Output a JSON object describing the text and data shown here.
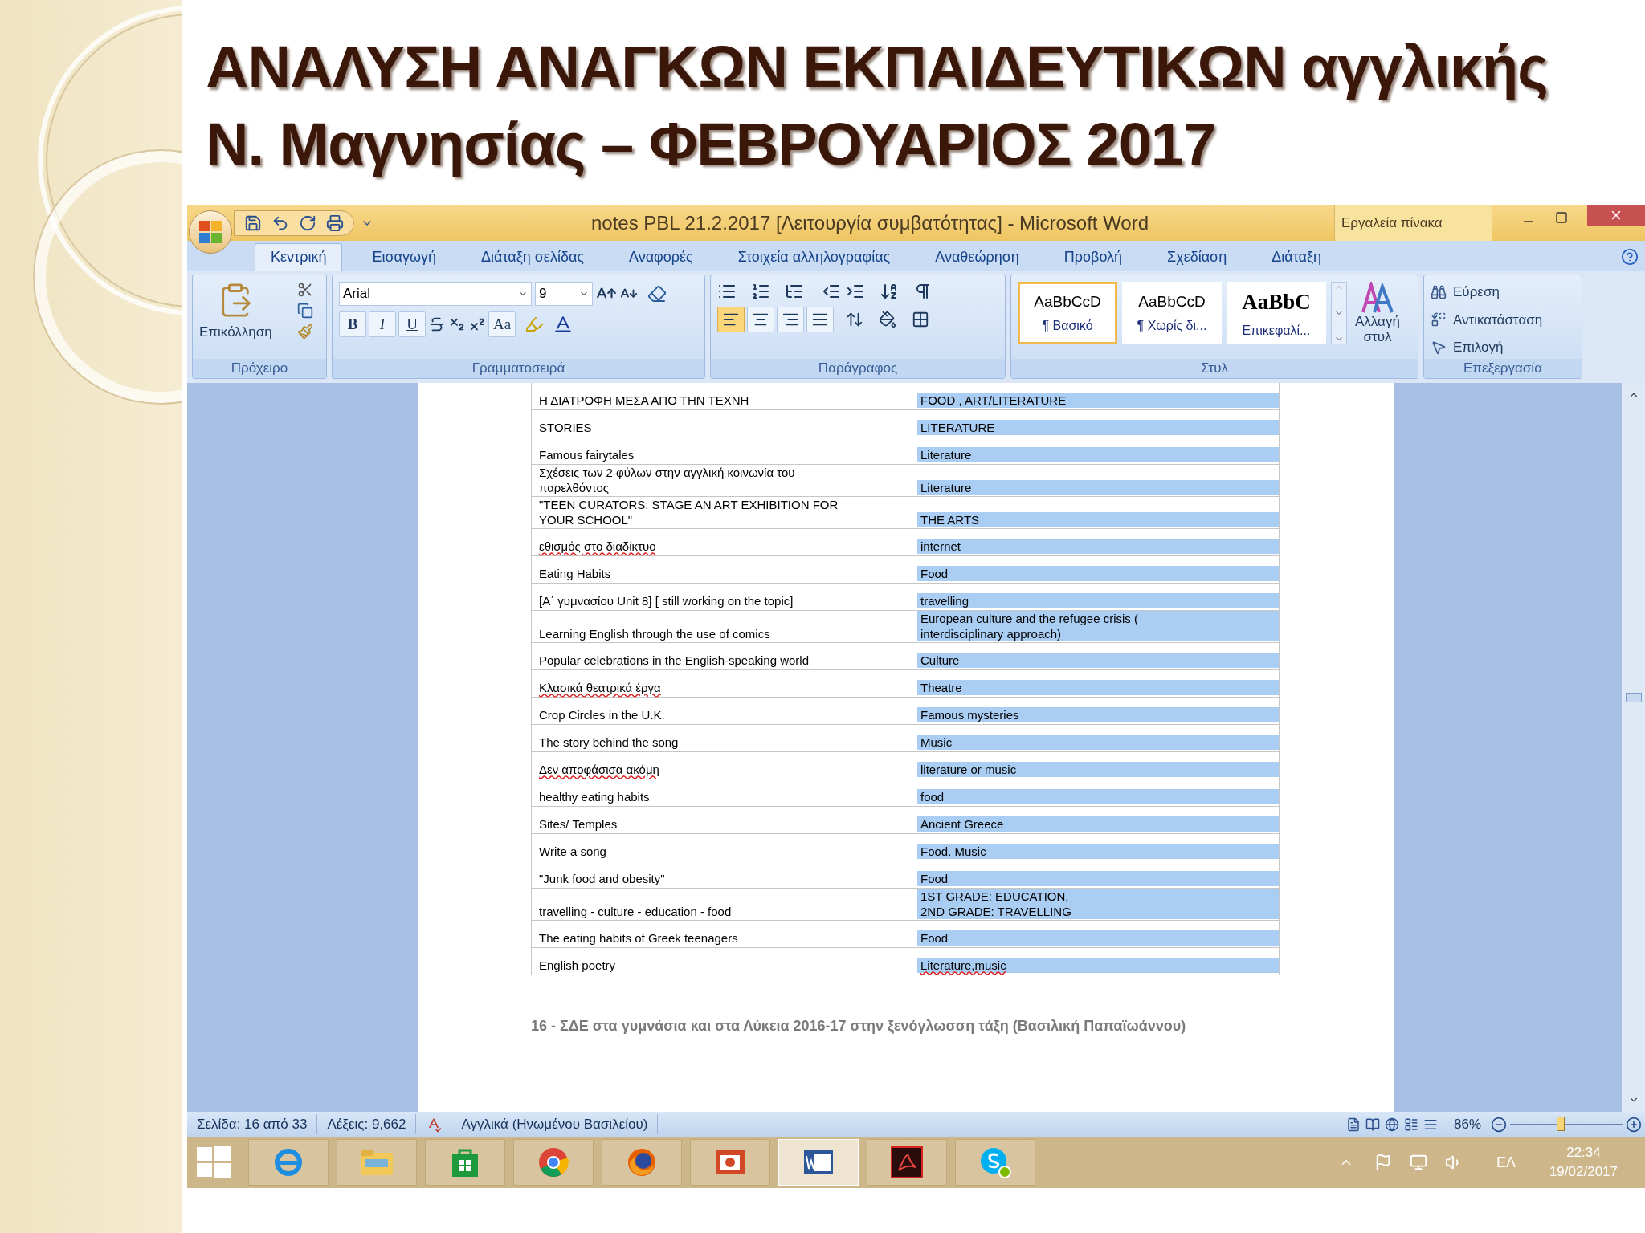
{
  "slide": {
    "title_lines": [
      "ΑΝΑΛΥΣΗ ΑΝΑΓΚΩΝ ΕΚΠΑΙΔΕΥΤΙΚΩΝ αγγλικής",
      "Ν. Μαγνησίας – ΦΕΒΡΟΥΑΡΙΟΣ 2017"
    ]
  },
  "window": {
    "title": "notes PBL 21.2.2017 [Λειτουργία συμβατότητας] - Microsoft Word",
    "context_group": "Εργαλεία πίνακα"
  },
  "tabs": [
    {
      "label": "Κεντρική",
      "selected": true
    },
    {
      "label": "Εισαγωγή",
      "selected": false
    },
    {
      "label": "Διάταξη σελίδας",
      "selected": false
    },
    {
      "label": "Αναφορές",
      "selected": false
    },
    {
      "label": "Στοιχεία αλληλογραφίας",
      "selected": false
    },
    {
      "label": "Αναθεώρηση",
      "selected": false
    },
    {
      "label": "Προβολή",
      "selected": false
    },
    {
      "label": "Σχεδίαση",
      "selected": false
    },
    {
      "label": "Διάταξη",
      "selected": false
    }
  ],
  "ribbon": {
    "clipboard": {
      "label": "Πρόχειρο",
      "paste": "Επικόλληση"
    },
    "font": {
      "label": "Γραμματοσειρά",
      "family": "Arial",
      "size": "9",
      "format_buttons": [
        "B",
        "I",
        "U",
        "Aa"
      ]
    },
    "paragraph": {
      "label": "Παράγραφος",
      "align_buttons": [
        {
          "kind": "left",
          "selected": true
        },
        {
          "kind": "center",
          "selected": false
        },
        {
          "kind": "right",
          "selected": false
        },
        {
          "kind": "justify",
          "selected": false
        }
      ]
    },
    "styles": {
      "label": "Στυλ",
      "gallery": [
        {
          "preview": "AaBbCcD",
          "name": "¶ Βασικό",
          "kind": "normal",
          "selected": true
        },
        {
          "preview": "AaBbCcD",
          "name": "¶ Χωρίς δι...",
          "kind": "normal",
          "selected": false
        },
        {
          "preview": "AaBbC",
          "name": "Επικεφαλί...",
          "kind": "heading",
          "selected": false
        }
      ],
      "change": [
        "Αλλαγή",
        "στυλ"
      ]
    },
    "editing": {
      "label": "Επεξεργασία",
      "items": [
        {
          "kind": "find",
          "label": "Εύρεση"
        },
        {
          "kind": "replace",
          "label": "Αντικατάσταση"
        },
        {
          "kind": "select",
          "label": "Επιλογή"
        }
      ]
    }
  },
  "document": {
    "rows": [
      {
        "cells": [
          {
            "text": "Η ΔΙΑΤΡΟΦΗ ΜΕΣΑ ΑΠΟ ΤΗΝ ΤΕΧΝΗ",
            "selected": false
          },
          {
            "text": "FOOD , ART/LITERATURE",
            "selected": true
          }
        ]
      },
      {
        "cells": [
          {
            "text": "STORIES",
            "selected": false
          },
          {
            "text": "LITERATURE",
            "selected": true
          }
        ]
      },
      {
        "cells": [
          {
            "text": "Famous fairytales",
            "selected": false
          },
          {
            "text": "Literature",
            "selected": true
          }
        ]
      },
      {
        "cells": [
          {
            "text": "Σχέσεις  των 2 φύλων στην  αγγλική κοινωνία του\nπαρελθόντος",
            "selected": false
          },
          {
            "text": "Literature",
            "selected": true
          }
        ]
      },
      {
        "cells": [
          {
            "text": "\"TEEN CURATORS:  STAGE AN ART EXHIBITION FOR\nYOUR SCHOOL\"",
            "selected": false
          },
          {
            "text": "THE ARTS",
            "selected": true
          }
        ]
      },
      {
        "cells": [
          {
            "text": "εθισμός στο διαδίκτυο",
            "selected": false,
            "spell_error": true
          },
          {
            "text": "internet",
            "selected": true
          }
        ]
      },
      {
        "cells": [
          {
            "text": "Eating Habits",
            "selected": false
          },
          {
            "text": "Food",
            "selected": true
          }
        ]
      },
      {
        "cells": [
          {
            "text": "[Α΄ γυμνασίου  Unit 8] [ still working on the topic]",
            "selected": false
          },
          {
            "text": "travelling",
            "selected": true
          }
        ]
      },
      {
        "cells": [
          {
            "text": "Learning English through the use of comics",
            "selected": false
          },
          {
            "text": "European culture and the refugee crisis  (\ninterdisciplinary approach)",
            "selected": true
          }
        ]
      },
      {
        "cells": [
          {
            "text": "Popular celebrations in the English-speaking world",
            "selected": false
          },
          {
            "text": "Culture",
            "selected": true
          }
        ]
      },
      {
        "cells": [
          {
            "text": "Κλασικά θεατρικά έργα",
            "selected": false,
            "spell_error": true
          },
          {
            "text": "Theatre",
            "selected": true
          }
        ]
      },
      {
        "cells": [
          {
            "text": "Crop Circles  in the U.K.",
            "selected": false
          },
          {
            "text": "Famous mysteries",
            "selected": true
          }
        ]
      },
      {
        "cells": [
          {
            "text": "The story behind the song",
            "selected": false
          },
          {
            "text": "Music",
            "selected": true
          }
        ]
      },
      {
        "cells": [
          {
            "text": "Δεν αποφάσισα ακόμη",
            "selected": false,
            "spell_error": true
          },
          {
            "text": "literature or music",
            "selected": true
          }
        ]
      },
      {
        "cells": [
          {
            "text": "healthy eating habits",
            "selected": false
          },
          {
            "text": "food",
            "selected": true
          }
        ]
      },
      {
        "cells": [
          {
            "text": "Sites/ Temples",
            "selected": false
          },
          {
            "text": "Ancient Greece",
            "selected": true
          }
        ]
      },
      {
        "cells": [
          {
            "text": "Write a song",
            "selected": false
          },
          {
            "text": "Food. Music",
            "selected": true
          }
        ]
      },
      {
        "cells": [
          {
            "text": "\"Junk food and obesity\"",
            "selected": false
          },
          {
            "text": "Food",
            "selected": true
          }
        ]
      },
      {
        "cells": [
          {
            "text": "travelling - culture - education - food",
            "selected": false
          },
          {
            "text": "1ST GRADE:  EDUCATION,\n2ND GRADE: TRAVELLING",
            "selected": true
          }
        ]
      },
      {
        "cells": [
          {
            "text": "The eating habits of Greek teenagers",
            "selected": false
          },
          {
            "text": "Food",
            "selected": true
          }
        ]
      },
      {
        "cells": [
          {
            "text": "English poetry",
            "selected": false
          },
          {
            "text": "Literature,music",
            "selected": true,
            "spell_error": true
          }
        ]
      }
    ],
    "footer": "16 -  ΣΔΕ στα γυμνάσια και στα Λύκεια 2016-17 στην ξενόγλωσση τάξη (Βασιλική Παπαϊωάννου)"
  },
  "status_bar": {
    "page": "Σελίδα: 16 από 33",
    "words": "Λέξεις: 9,662",
    "language": "Αγγλικά (Ηνωμένου Βασιλείου)",
    "zoom": "86%",
    "zoom_slider": {
      "level": 0.45
    }
  },
  "taskbar": {
    "apps": [
      {
        "kind": "ie",
        "selected": false
      },
      {
        "kind": "explorer",
        "selected": false
      },
      {
        "kind": "store",
        "selected": false
      },
      {
        "kind": "chrome",
        "selected": false
      },
      {
        "kind": "firefox",
        "selected": false
      },
      {
        "kind": "powerpoint",
        "selected": false
      },
      {
        "kind": "word",
        "selected": true
      },
      {
        "kind": "acrobat",
        "selected": false
      },
      {
        "kind": "skype",
        "selected": false
      }
    ],
    "language": "ΕΛ",
    "time": "22:34",
    "date": "19/02/2017"
  }
}
